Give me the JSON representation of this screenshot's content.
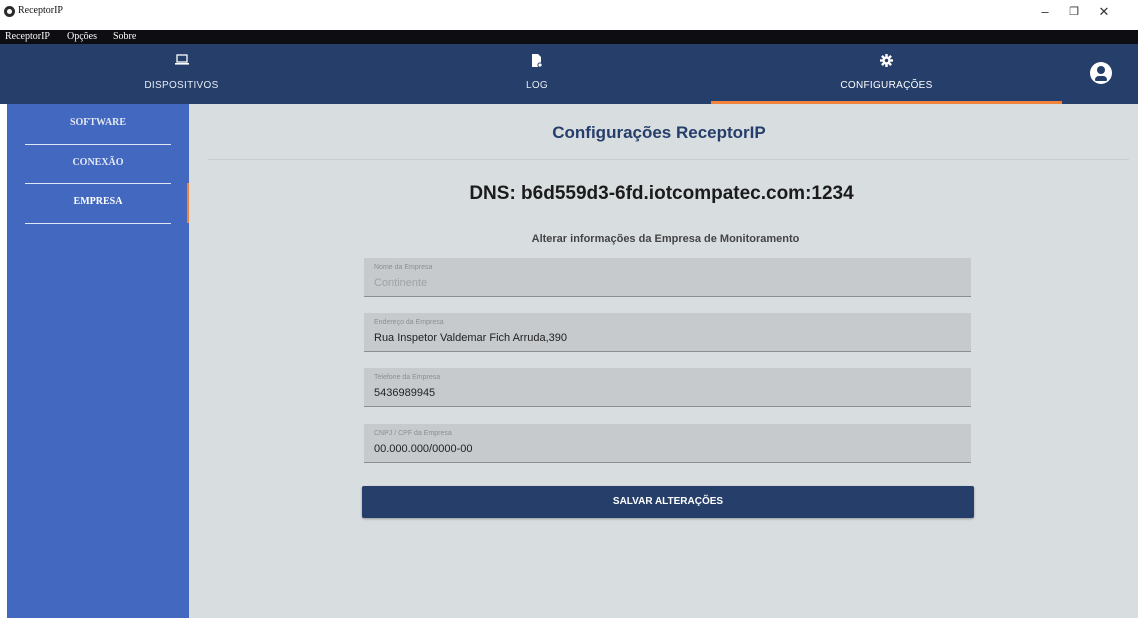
{
  "window": {
    "title": "ReceptorIP"
  },
  "menu": [
    "ReceptorIP",
    "Opções",
    "Sobre"
  ],
  "tabs": [
    {
      "label": "DISPOSITIVOS",
      "icon": "laptop-icon"
    },
    {
      "label": "LOG",
      "icon": "log-file-icon"
    },
    {
      "label": "CONFIGURAÇÕES",
      "icon": "gear-icon",
      "active": true
    }
  ],
  "sidebar": {
    "items": [
      {
        "label": "SOFTWARE"
      },
      {
        "label": "CONEXÃO"
      },
      {
        "label": "EMPRESA",
        "active": true
      }
    ]
  },
  "main": {
    "title": "Configurações ReceptorIP",
    "dns": "DNS: b6d559d3-6fd.iotcompatec.com:1234",
    "subtitle": "Alterar informações da Empresa de Monitoramento",
    "fields": [
      {
        "label": "Nome da Empresa",
        "value": "Continente",
        "disabled": true
      },
      {
        "label": "Endereço da Empresa",
        "value": "Rua Inspetor Valdemar Fich Arruda,390"
      },
      {
        "label": "Telefone da Empresa",
        "value": "5436989945"
      },
      {
        "label": "CNPJ / CPF da Empresa",
        "value": "00.000.000/0000-00"
      }
    ],
    "save_label": "SALVAR ALTERAÇÕES"
  },
  "colors": {
    "nav": "#253e6a",
    "accent": "#f0843c",
    "sidebar": "#4268c0",
    "content": "#d8dde0"
  }
}
